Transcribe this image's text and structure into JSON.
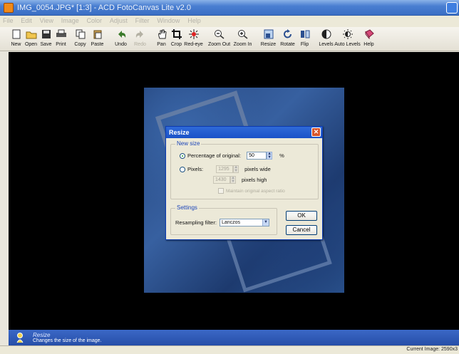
{
  "window": {
    "title": "IMG_0054.JPG* [1:3] - ACD FotoCanvas Lite v2.0"
  },
  "menu": [
    "File",
    "Edit",
    "View",
    "Image",
    "Color",
    "Adjust",
    "Filter",
    "Window",
    "Help"
  ],
  "toolbar": {
    "new": "New",
    "open": "Open",
    "save": "Save",
    "print": "Print",
    "copy": "Copy",
    "paste": "Paste",
    "undo": "Undo",
    "redo": "Redo",
    "pan": "Pan",
    "crop": "Crop",
    "redeye": "Red-eye",
    "zoomout": "Zoom Out",
    "zoomin": "Zoom In",
    "resize": "Resize",
    "rotate": "Rotate",
    "flip": "Flip",
    "levels": "Levels",
    "autolevels": "Auto Levels",
    "help": "Help"
  },
  "dialog": {
    "title": "Resize",
    "close": "✕",
    "new_size_label": "New size",
    "percentage_label": "Percentage of original:",
    "percentage_value": "50",
    "percent_unit": "%",
    "pixels_label": "Pixels:",
    "width_value": "1295",
    "height_value": "1430",
    "pixels_wide": "pixels wide",
    "pixels_high": "pixels high",
    "maintain_aspect": "Maintain original aspect ratio",
    "settings_label": "Settings",
    "resampling_label": "Resampling filter:",
    "resampling_value": "Lanczos",
    "ok": "OK",
    "cancel": "Cancel",
    "selected_mode": "percentage"
  },
  "status": {
    "title": "Resize",
    "description": "Changes the size of the image."
  },
  "bottom": {
    "current_image": "Current Image: 2590x3"
  }
}
